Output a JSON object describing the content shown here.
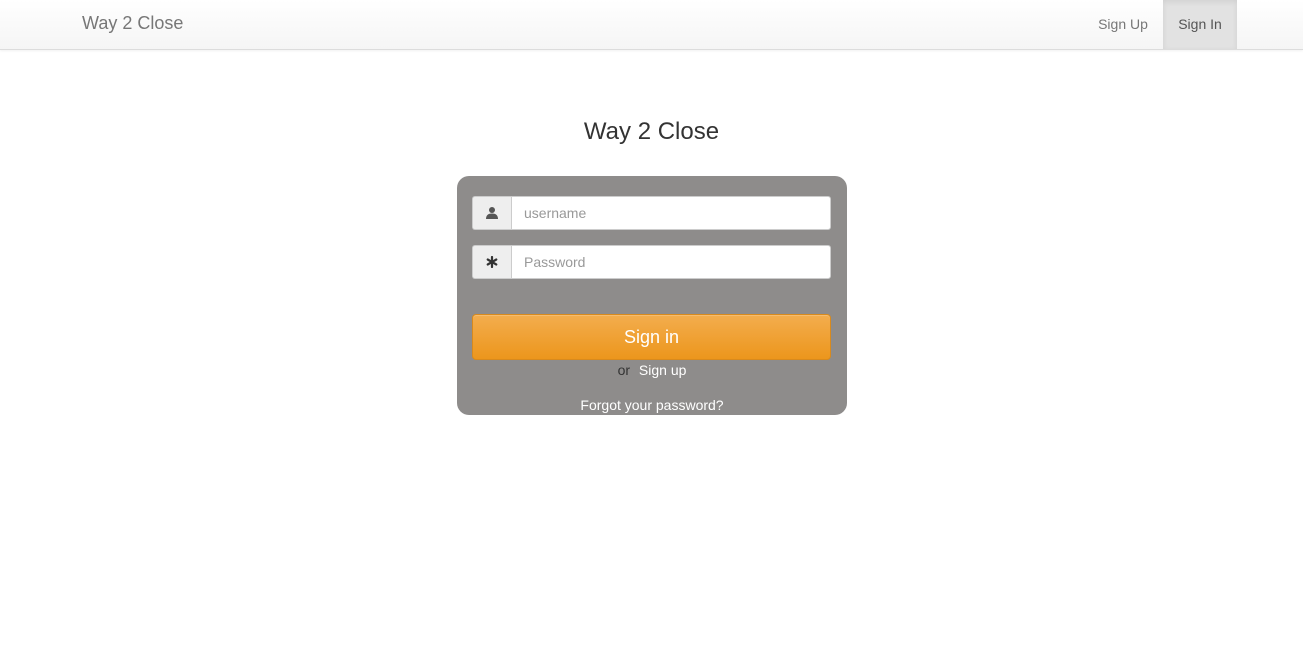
{
  "navbar": {
    "brand": "Way 2 Close",
    "links": [
      {
        "label": "Sign Up"
      },
      {
        "label": "Sign In",
        "active": true
      }
    ]
  },
  "main": {
    "title": "Way 2 Close"
  },
  "login_form": {
    "username": {
      "icon": "user-icon",
      "placeholder": "username",
      "value": ""
    },
    "password": {
      "icon": "asterisk-icon",
      "placeholder": "Password",
      "value": ""
    },
    "submit_label": "Sign in",
    "or_text": "or",
    "signup_label": "Sign up",
    "forgot_label": "Forgot your password?"
  },
  "colors": {
    "panel_bg": "#8e8c8b",
    "button_accent": "#ec961c",
    "nav_active_bg": "#e2e2e2"
  }
}
